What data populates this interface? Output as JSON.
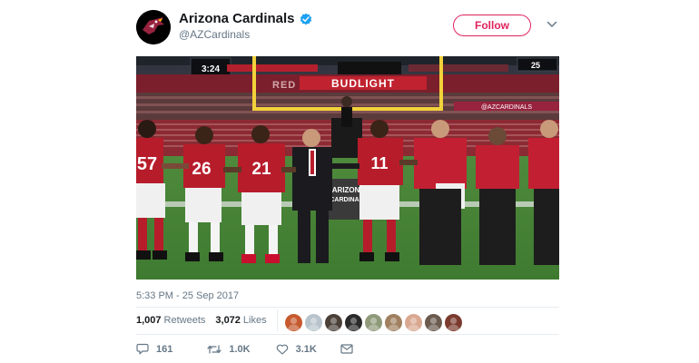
{
  "account": {
    "name": "Arizona Cardinals",
    "handle": "@AZCardinals",
    "follow_label": "Follow",
    "brand_color": "#97233f",
    "accent_color": "#e0245e",
    "verified_color": "#1da1f2"
  },
  "photo": {
    "scoreboard_left": "3:24",
    "scoreboard_right": "25",
    "banner_text": "BUDLIGHT",
    "ribbon_text": "@AZCARDINALS",
    "sign_text": "ARIZONA",
    "sign_text2": "CARDINALS",
    "jerseys": [
      "57",
      "26",
      "21",
      "11"
    ]
  },
  "timestamp": "5:33 PM - 25 Sep 2017",
  "stats": {
    "retweets_count": "1,007",
    "retweets_label": "Retweets",
    "likes_count": "3,072",
    "likes_label": "Likes"
  },
  "likers": [
    {
      "icon": "liker-avatar-1",
      "color": "#c65a2e"
    },
    {
      "icon": "liker-avatar-2",
      "color": "#b8c4cc"
    },
    {
      "icon": "liker-avatar-3",
      "color": "#4b4038"
    },
    {
      "icon": "liker-avatar-4",
      "color": "#2a2a2a"
    },
    {
      "icon": "liker-avatar-5",
      "color": "#8f9a7a"
    },
    {
      "icon": "liker-avatar-6",
      "color": "#a08060"
    },
    {
      "icon": "liker-avatar-7",
      "color": "#d9a890"
    },
    {
      "icon": "liker-avatar-8",
      "color": "#6b5b4e"
    },
    {
      "icon": "liker-avatar-9",
      "color": "#7a3b2e"
    }
  ],
  "actions": {
    "replies": "161",
    "retweets": "1.0K",
    "likes": "3.1K"
  }
}
